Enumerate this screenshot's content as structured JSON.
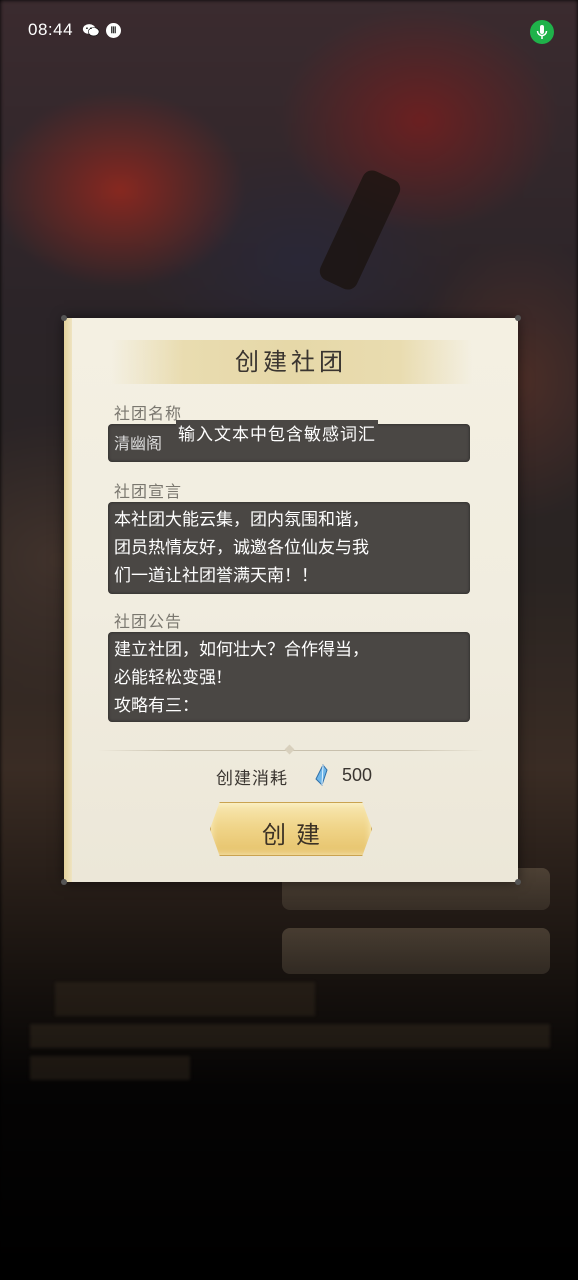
{
  "status_bar": {
    "time": "08:44",
    "gg_badge": "Ⅲ",
    "icons": [
      "wechat-icon",
      "gg-icon",
      "mic-icon"
    ],
    "mic_color": "#1fb24a"
  },
  "dialog": {
    "title": "创建社团",
    "name_label": "社团名称",
    "name_value": "清幽阁",
    "name_warning": "输入文本中包含敏感词汇",
    "declaration_label": "社团宣言",
    "declaration_lines": [
      "本社团大能云集，团内氛围和谐，",
      "团员热情友好，诚邀各位仙友与我",
      "们一道让社团誉满天南！！"
    ],
    "notice_label": "社团公告",
    "notice_lines": [
      "建立社团，如何壮大？合作得当，",
      "必能轻松变强!",
      "攻略有三："
    ],
    "cost_label": "创建消耗",
    "cost_icon": "spirit-crystal-icon",
    "cost_value": "500",
    "create_button": "创建"
  }
}
